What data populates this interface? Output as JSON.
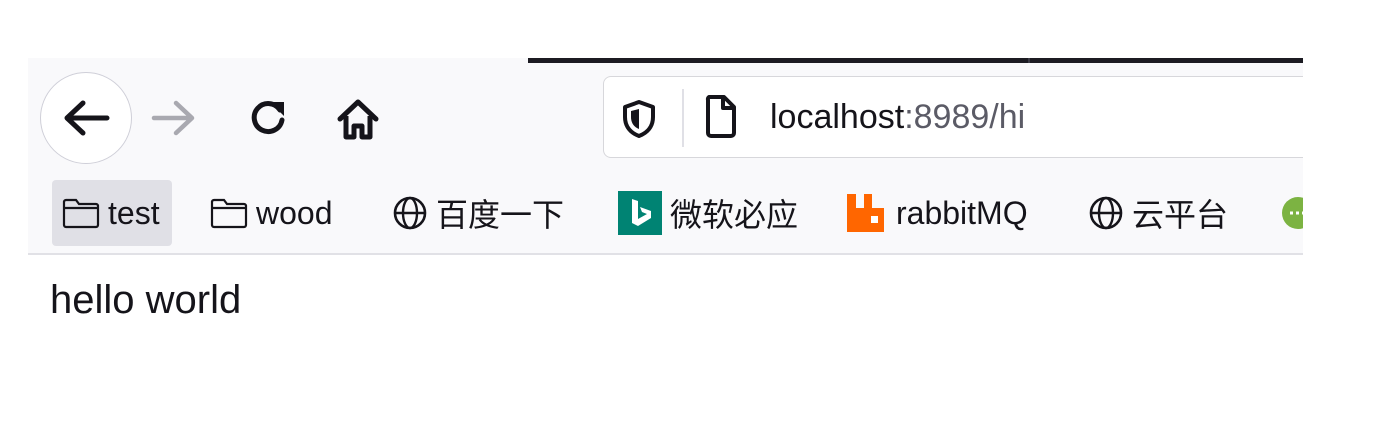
{
  "urlbar": {
    "host": "localhost",
    "path": ":8989/hi"
  },
  "bookmarks": [
    {
      "label": "test",
      "icon": "folder-icon"
    },
    {
      "label": "wood",
      "icon": "folder-icon"
    },
    {
      "label": "百度一下",
      "icon": "globe-icon"
    },
    {
      "label": "微软必应",
      "icon": "bing-icon"
    },
    {
      "label": "rabbitMQ",
      "icon": "rabbitmq-icon"
    },
    {
      "label": "云平台",
      "icon": "globe-icon"
    },
    {
      "label": "",
      "icon": "partial-green-icon"
    }
  ],
  "colors": {
    "bing": "#008373",
    "rabbitmq": "#ff6600",
    "partial_icon": "#7cb342"
  },
  "page": {
    "body_text": "hello world"
  }
}
